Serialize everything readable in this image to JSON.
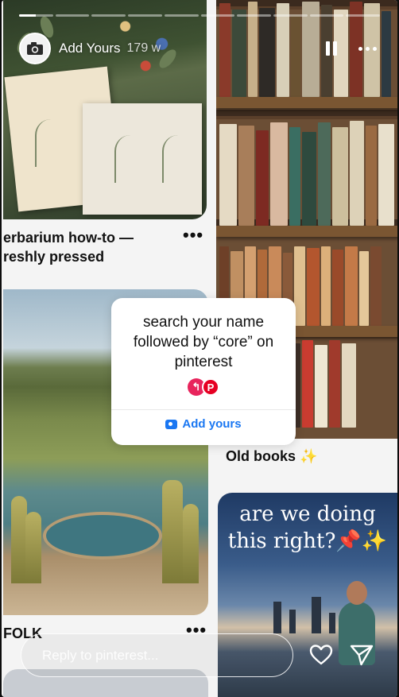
{
  "progress": {
    "segments": 10,
    "active_index": 0,
    "active_fill": 0.5
  },
  "header": {
    "avatar_icon": "camera-icon",
    "title": "Add Yours",
    "age": "179 w",
    "pause_icon": "pause-icon",
    "more_icon": "more-icon"
  },
  "pins": [
    {
      "caption": "erbarium how-to —\nreshly pressed",
      "more": "•••"
    },
    {
      "caption": "Old books ✨",
      "more": ""
    },
    {
      "caption": "FOLK",
      "more": "•••"
    },
    {
      "caption": "are we doing\nthis right?📌✨",
      "more": ""
    }
  ],
  "sticker": {
    "prompt": "search your name followed by “core” on pinterest",
    "button_label": "Add yours",
    "icons": [
      "back-arrow-icon",
      "pinterest-icon"
    ]
  },
  "reply": {
    "placeholder": "Reply to pinterest...",
    "like_icon": "heart-icon",
    "send_icon": "send-icon"
  },
  "colors": {
    "accent": "#1a77f2",
    "pinterest": "#e60023",
    "sticker_back": "#e8245c"
  }
}
